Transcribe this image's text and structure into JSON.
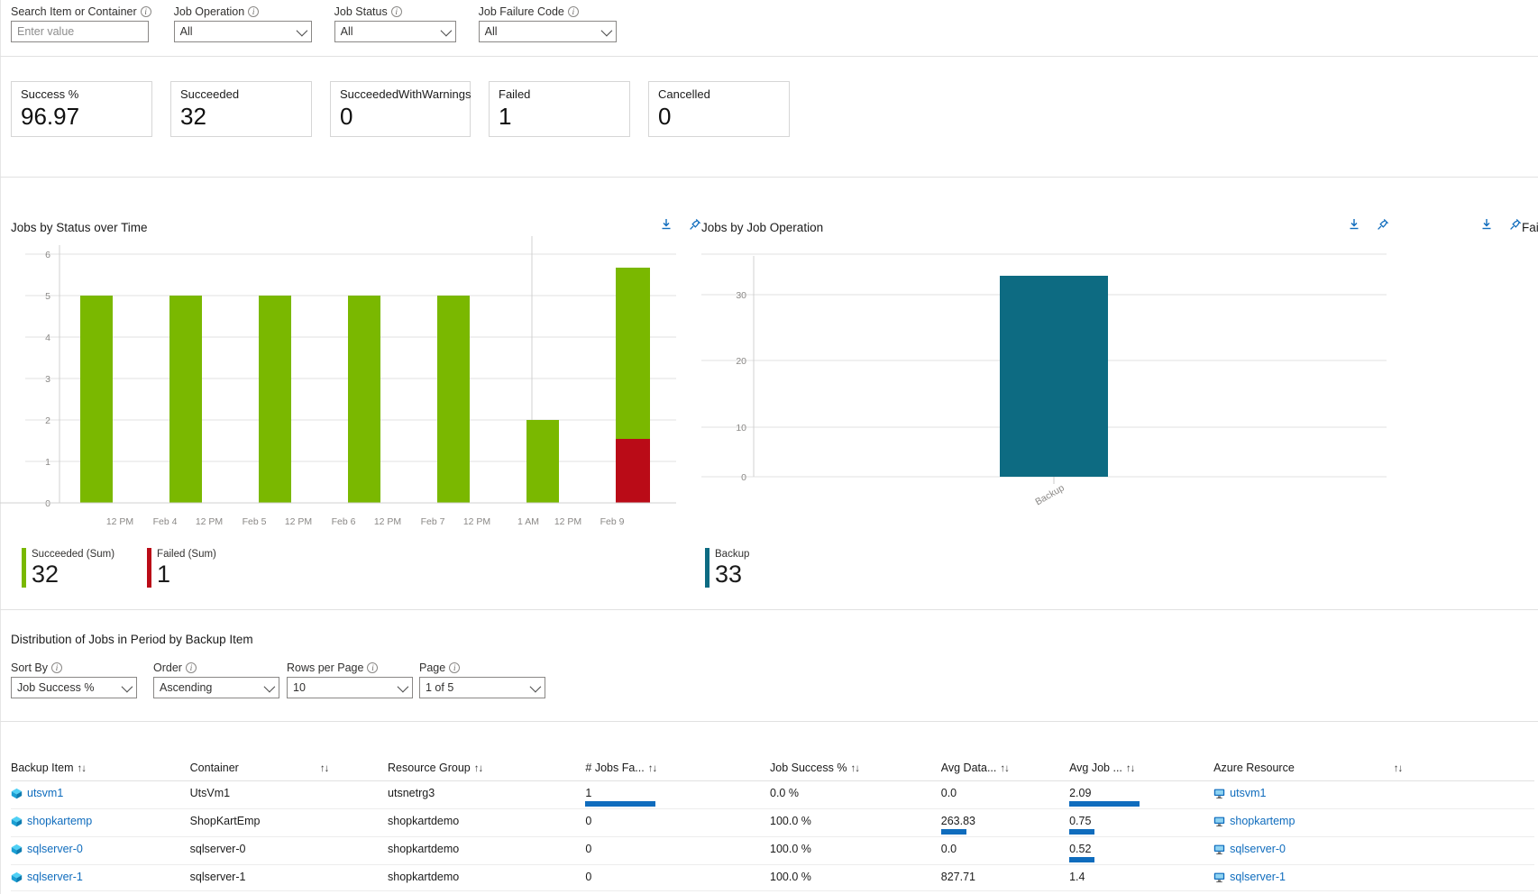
{
  "filters": [
    {
      "label": "Search Item or Container",
      "type": "text",
      "value": "",
      "placeholder": "Enter value",
      "name": "search-item-or-container"
    },
    {
      "label": "Job Operation",
      "type": "select",
      "value": "All",
      "name": "job-operation"
    },
    {
      "label": "Job Status",
      "type": "select",
      "value": "All",
      "name": "job-status"
    },
    {
      "label": "Job Failure Code",
      "type": "select",
      "value": "All",
      "name": "job-failure-code"
    }
  ],
  "kpis": [
    {
      "label": "Success %",
      "value": "96.97"
    },
    {
      "label": "Succeeded",
      "value": "32"
    },
    {
      "label": "SucceededWithWarnings",
      "value": "0"
    },
    {
      "label": "Failed",
      "value": "1"
    },
    {
      "label": "Cancelled",
      "value": "0"
    }
  ],
  "panels": {
    "jobs_by_status": {
      "title": "Jobs by Status over Time",
      "download_icon": "download-icon",
      "pin_icon": "pin-icon"
    },
    "jobs_by_operation": {
      "title": "Jobs by Job Operation",
      "download_icon": "download-icon",
      "pin_icon": "pin-icon"
    },
    "failed_panel": {
      "title": "Failed"
    }
  },
  "chart_data": [
    {
      "type": "bar",
      "title": "Jobs by Status over Time",
      "xlabel": "",
      "ylabel": "",
      "ylim": [
        0,
        6
      ],
      "yticks": [
        0,
        1,
        2,
        3,
        4,
        5,
        6
      ],
      "grid": true,
      "stacked": true,
      "categories": [
        "12 PM",
        "Feb 4",
        "12 PM",
        "Feb 5",
        "12 PM",
        "Feb 6",
        "12 PM",
        "Feb 7",
        "12 PM",
        "1 AM",
        "12 PM",
        "Feb 9"
      ],
      "bars": [
        {
          "tick": "12 PM",
          "succeeded": 0,
          "failed": 0
        },
        {
          "tick": "Feb 4",
          "succeeded": 5,
          "failed": 0
        },
        {
          "tick": "12 PM",
          "succeeded": 0,
          "failed": 0
        },
        {
          "tick": "Feb 5",
          "succeeded": 5,
          "failed": 0
        },
        {
          "tick": "12 PM",
          "succeeded": 0,
          "failed": 0
        },
        {
          "tick": "Feb 6",
          "succeeded": 5,
          "failed": 0
        },
        {
          "tick": "12 PM",
          "succeeded": 0,
          "failed": 0
        },
        {
          "tick": "Feb 7",
          "succeeded": 5,
          "failed": 0
        },
        {
          "tick": "12 PM",
          "succeeded": 0,
          "failed": 0
        },
        {
          "tick": "1 AM",
          "succeeded": 5,
          "failed": 0
        },
        {
          "tick": "12 PM",
          "succeeded": 2,
          "failed": 0
        },
        {
          "tick": "Feb 9",
          "succeeded": 4.8,
          "failed": 1.2
        }
      ],
      "series": [
        {
          "name": "Succeeded (Sum)",
          "color": "#7ab800",
          "total": "32"
        },
        {
          "name": "Failed (Sum)",
          "color": "#ba0b17",
          "total": "1"
        }
      ],
      "legend_position": "bottom"
    },
    {
      "type": "bar",
      "title": "Jobs by Job Operation",
      "xlabel": "",
      "ylabel": "",
      "ylim": [
        0,
        35
      ],
      "yticks": [
        0,
        10,
        20,
        30
      ],
      "grid": true,
      "categories": [
        "Backup"
      ],
      "values": [
        33
      ],
      "series": [
        {
          "name": "Backup",
          "color": "#0d6b82",
          "total": "33"
        }
      ],
      "legend_position": "bottom"
    }
  ],
  "distribution": {
    "title": "Distribution of Jobs in Period by Backup Item",
    "controls": [
      {
        "label": "Sort By",
        "value": "Job Success %",
        "name": "sort-by"
      },
      {
        "label": "Order",
        "value": "Ascending",
        "name": "order"
      },
      {
        "label": "Rows per Page",
        "value": "10",
        "name": "rows-per-page"
      },
      {
        "label": "Page",
        "value": "1 of 5",
        "name": "page"
      }
    ],
    "columns": [
      {
        "label": "Backup Item",
        "sortable": true
      },
      {
        "label": "Container",
        "sortable": true
      },
      {
        "label": "Resource Group",
        "sortable": true
      },
      {
        "label": "# Jobs Fa...",
        "sortable": true
      },
      {
        "label": "Job Success %",
        "sortable": true
      },
      {
        "label": "Avg Data...",
        "sortable": true
      },
      {
        "label": "Avg Job ...",
        "sortable": true
      },
      {
        "label": "Azure Resource",
        "sortable": true
      }
    ],
    "rows": [
      {
        "backup_item": "utsvm1",
        "container": "UtsVm1",
        "resource_group": "utsnetrg3",
        "jobs_failed": "1",
        "jobs_failed_bar": 100,
        "job_success": "0.0 %",
        "avg_data": "0.0",
        "avg_data_bar": 0,
        "avg_job": "2.09",
        "avg_job_bar": 100,
        "azure_resource": "utsvm1"
      },
      {
        "backup_item": "shopkartemp",
        "container": "ShopKartEmp",
        "resource_group": "shopkartdemo",
        "jobs_failed": "0",
        "jobs_failed_bar": 0,
        "job_success": "100.0 %",
        "avg_data": "263.83",
        "avg_data_bar": 32,
        "avg_job": "0.75",
        "avg_job_bar": 36,
        "azure_resource": "shopkartemp"
      },
      {
        "backup_item": "sqlserver-0",
        "container": "sqlserver-0",
        "resource_group": "shopkartdemo",
        "jobs_failed": "0",
        "jobs_failed_bar": 0,
        "job_success": "100.0 %",
        "avg_data": "0.0",
        "avg_data_bar": 0,
        "avg_job": "0.52",
        "avg_job_bar": 25,
        "azure_resource": "sqlserver-0"
      },
      {
        "backup_item": "sqlserver-1",
        "container": "sqlserver-1",
        "resource_group": "shopkartdemo",
        "jobs_failed": "0",
        "jobs_failed_bar": 0,
        "job_success": "100.0 %",
        "avg_data": "827.71",
        "avg_data_bar": 0,
        "avg_job": "1.4",
        "avg_job_bar": 0,
        "azure_resource": "sqlserver-1"
      }
    ]
  },
  "colors": {
    "succeeded": "#7ab800",
    "failed": "#ba0b17",
    "backup": "#0d6b82",
    "link": "#0f6cbd",
    "bar": "#0f6cbd"
  }
}
